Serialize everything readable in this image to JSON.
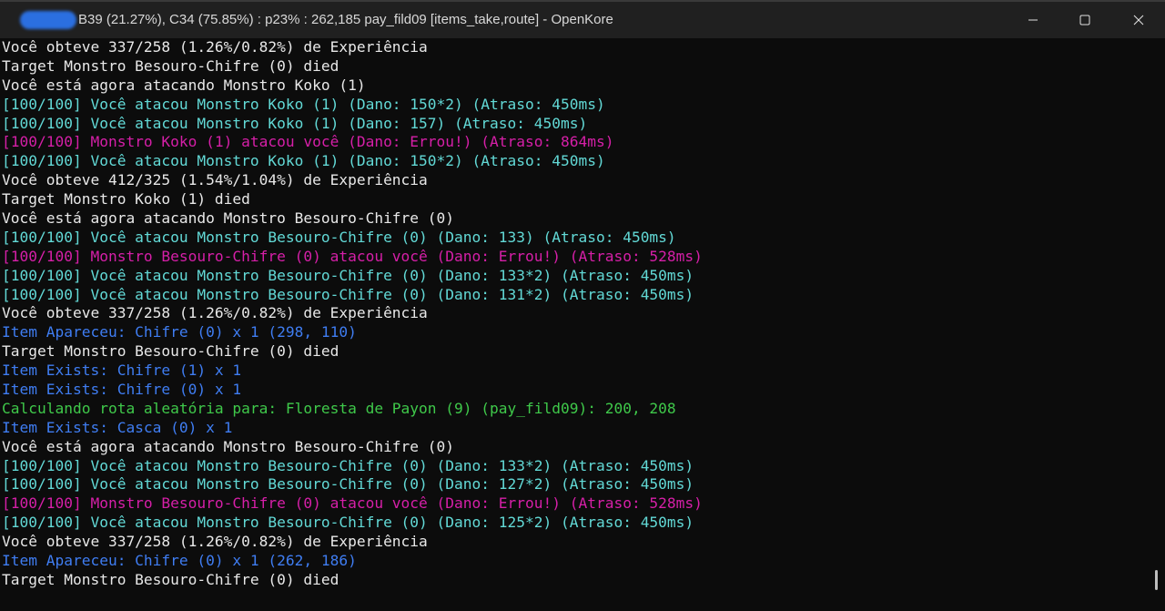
{
  "window": {
    "title": "B39 (21.27%), C34 (75.85%) : p23% : 262,185 pay_fild09 [items_take,route] - OpenKore",
    "controls": {
      "minimize": "minimize-icon",
      "maximize": "maximize-icon",
      "close": "close-icon"
    }
  },
  "colors": {
    "white": "#e8e8e8",
    "cyan": "#62d9d6",
    "magenta": "#d61fa8",
    "blue": "#3f7df2",
    "green": "#3fc94a",
    "background": "#0c0c0c"
  },
  "console": {
    "lines": [
      {
        "color": "white",
        "text": "Você obteve 337/258 (1.26%/0.82%) de Experiência"
      },
      {
        "color": "white",
        "text": "Target Monstro Besouro-Chifre (0) died"
      },
      {
        "color": "white",
        "text": "Você está agora atacando Monstro Koko (1)"
      },
      {
        "color": "cyan",
        "text": "[100/100] Você atacou Monstro Koko (1) (Dano: 150*2) (Atraso: 450ms)"
      },
      {
        "color": "cyan",
        "text": "[100/100] Você atacou Monstro Koko (1) (Dano: 157) (Atraso: 450ms)"
      },
      {
        "color": "magenta",
        "text": "[100/100] Monstro Koko (1) atacou você (Dano: Errou!) (Atraso: 864ms)"
      },
      {
        "color": "cyan",
        "text": "[100/100] Você atacou Monstro Koko (1) (Dano: 150*2) (Atraso: 450ms)"
      },
      {
        "color": "white",
        "text": "Você obteve 412/325 (1.54%/1.04%) de Experiência"
      },
      {
        "color": "white",
        "text": "Target Monstro Koko (1) died"
      },
      {
        "color": "white",
        "text": "Você está agora atacando Monstro Besouro-Chifre (0)"
      },
      {
        "color": "cyan",
        "text": "[100/100] Você atacou Monstro Besouro-Chifre (0) (Dano: 133) (Atraso: 450ms)"
      },
      {
        "color": "magenta",
        "text": "[100/100] Monstro Besouro-Chifre (0) atacou você (Dano: Errou!) (Atraso: 528ms)"
      },
      {
        "color": "cyan",
        "text": "[100/100] Você atacou Monstro Besouro-Chifre (0) (Dano: 133*2) (Atraso: 450ms)"
      },
      {
        "color": "cyan",
        "text": "[100/100] Você atacou Monstro Besouro-Chifre (0) (Dano: 131*2) (Atraso: 450ms)"
      },
      {
        "color": "white",
        "text": "Você obteve 337/258 (1.26%/0.82%) de Experiência"
      },
      {
        "color": "blue",
        "text": "Item Apareceu: Chifre (0) x 1 (298, 110)"
      },
      {
        "color": "white",
        "text": "Target Monstro Besouro-Chifre (0) died"
      },
      {
        "color": "blue",
        "text": "Item Exists: Chifre (1) x 1"
      },
      {
        "color": "blue",
        "text": "Item Exists: Chifre (0) x 1"
      },
      {
        "color": "green",
        "text": "Calculando rota aleatória para: Floresta de Payon (9) (pay_fild09): 200, 208"
      },
      {
        "color": "blue",
        "text": "Item Exists: Casca (0) x 1"
      },
      {
        "color": "white",
        "text": "Você está agora atacando Monstro Besouro-Chifre (0)"
      },
      {
        "color": "cyan",
        "text": "[100/100] Você atacou Monstro Besouro-Chifre (0) (Dano: 133*2) (Atraso: 450ms)"
      },
      {
        "color": "cyan",
        "text": "[100/100] Você atacou Monstro Besouro-Chifre (0) (Dano: 127*2) (Atraso: 450ms)"
      },
      {
        "color": "magenta",
        "text": "[100/100] Monstro Besouro-Chifre (0) atacou você (Dano: Errou!) (Atraso: 528ms)"
      },
      {
        "color": "cyan",
        "text": "[100/100] Você atacou Monstro Besouro-Chifre (0) (Dano: 125*2) (Atraso: 450ms)"
      },
      {
        "color": "white",
        "text": "Você obteve 337/258 (1.26%/0.82%) de Experiência"
      },
      {
        "color": "blue",
        "text": "Item Apareceu: Chifre (0) x 1 (262, 186)"
      },
      {
        "color": "white",
        "text": "Target Monstro Besouro-Chifre (0) died"
      }
    ]
  }
}
